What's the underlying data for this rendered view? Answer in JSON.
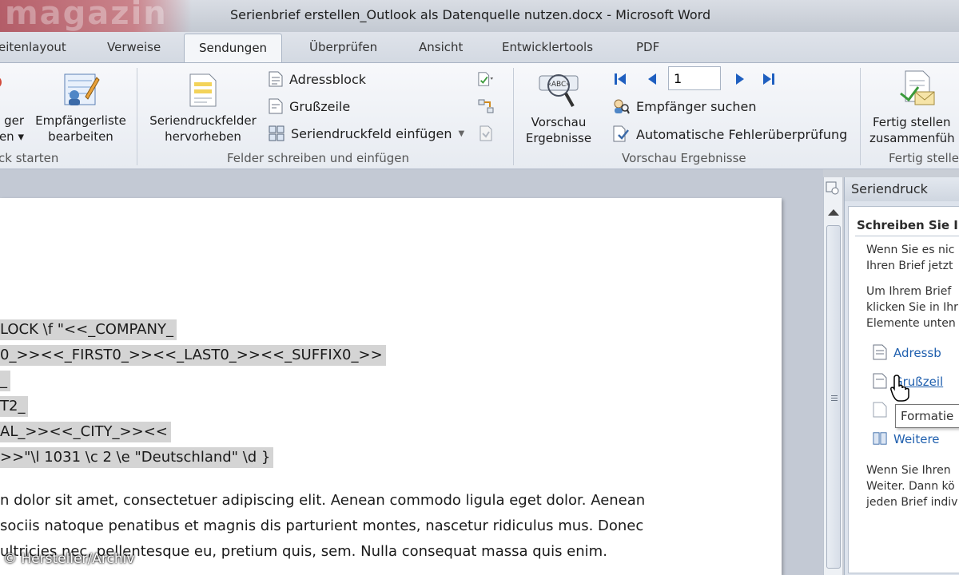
{
  "window": {
    "title": "Serienbrief erstellen_Outlook als Datenquelle nutzen.docx - Microsoft Word"
  },
  "tabs": [
    {
      "label": "eitenlayout"
    },
    {
      "label": "Verweise"
    },
    {
      "label": "Sendungen",
      "active": true
    },
    {
      "label": "Überprüfen"
    },
    {
      "label": "Ansicht"
    },
    {
      "label": "Entwicklertools"
    },
    {
      "label": "PDF"
    }
  ],
  "ribbon": {
    "start_group": {
      "choose_recipients": {
        "line1": "ger",
        "line2": "en"
      },
      "edit_list": {
        "line1": "Empfängerliste",
        "line2": "bearbeiten"
      },
      "label": "ck starten"
    },
    "fields_group": {
      "highlight": {
        "line1": "Seriendruckfelder",
        "line2": "hervorheben"
      },
      "address_block": "Adressblock",
      "greeting_line": "Grußzeile",
      "insert_field": "Seriendruckfeld einfügen",
      "label": "Felder schreiben und einfügen"
    },
    "preview_group": {
      "preview": {
        "line1": "Vorschau",
        "line2": "Ergebnisse"
      },
      "record_number": "1",
      "find_recipient": "Empfänger suchen",
      "auto_check": "Automatische Fehlerüberprüfung",
      "label": "Vorschau Ergebnisse"
    },
    "finish_group": {
      "finish": {
        "line1": "Fertig stellen",
        "line2": "zusammenfüh"
      },
      "label": "Fertig stelle"
    }
  },
  "document": {
    "field_lines": [
      "LOCK \\f \"<<_COMPANY_",
      "0_>><<_FIRST0_>><<_LAST0_>><<_SUFFIX0_>>",
      "_",
      "T2_",
      "AL_>><<_CITY_>><<",
      ">>\"\\l 1031 \\c 2 \\e \"Deutschland\" \\d }"
    ],
    "body_lines": [
      "n dolor sit amet, consectetuer adipiscing elit. Aenean commodo ligula eget dolor. Aenean",
      "sociis natoque penatibus et magnis dis parturient montes, nascetur ridiculus mus. Donec",
      "ultricies nec, pellentesque eu, pretium quis, sem. Nulla consequat massa quis enim."
    ]
  },
  "taskpane": {
    "title": "Seriendruck",
    "heading": "Schreiben Sie I",
    "para1": [
      "Wenn Sie es nic",
      "Ihren Brief jetzt"
    ],
    "para2": [
      "Um Ihrem Brief",
      "klicken Sie in Ihr",
      "Elemente unten"
    ],
    "links": [
      "Adressb",
      "Grußzeil",
      "Weitere"
    ],
    "tooltip": "Formatie",
    "para3": [
      "Wenn Sie Ihren",
      "Weiter. Dann kö",
      "jeden Brief indiv"
    ]
  },
  "credit": "© Hersteller/Archiv",
  "colors": {
    "link": "#1f5fae",
    "field_shading": "#d4d4d4",
    "ribbon_bg": "#eef1f6"
  }
}
